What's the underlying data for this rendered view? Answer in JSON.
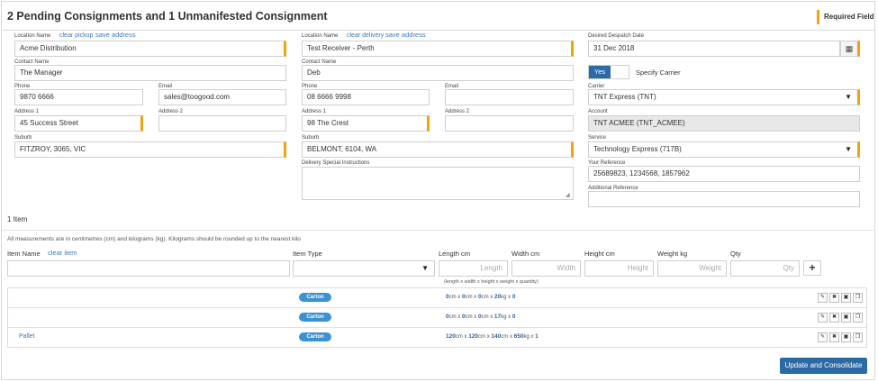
{
  "header": {
    "title": "2 Pending Consignments and 1 Unmanifested Consignment",
    "required_field": "Required Field"
  },
  "pickup": {
    "location_label": "Location Name",
    "clear_link": "clear pickup",
    "save_link": "save address",
    "location": "Acme Distribution",
    "contact_label": "Contact Name",
    "contact": "The Manager",
    "phone_label": "Phone",
    "phone": "9870 6666",
    "email_label": "Email",
    "email": "sales@toogood.com",
    "address1_label": "Address 1",
    "address1": "45 Success Street",
    "address2_label": "Address 2",
    "address2": "",
    "suburb_label": "Suburb",
    "suburb": "FITZROY, 3065, VIC"
  },
  "delivery": {
    "location_label": "Location Name",
    "clear_link": "clear delivery",
    "save_link": "save address",
    "location": "Test Receiver - Perth",
    "contact_label": "Contact Name",
    "contact": "Deb",
    "phone_label": "Phone",
    "phone": "08 6666 9998",
    "email_label": "Email",
    "email": "",
    "address1_label": "Address 1",
    "address1": "98 The Crest",
    "address2_label": "Address 2",
    "address2": "",
    "suburb_label": "Suburb",
    "suburb": "BELMONT, 6104, WA",
    "instructions_label": "Delivery Special Instructions",
    "instructions": ""
  },
  "despatch": {
    "date_label": "Desired Despatch Date",
    "date": "31 Dec 2018",
    "toggle_label": "Yes",
    "specify_carrier": "Specify Carrier",
    "carrier_label": "Carrier",
    "carrier": "TNT Express (TNT)",
    "account_label": "Account",
    "account": "TNT ACMEE (TNT_ACMEE)",
    "service_label": "Service",
    "service": "Technology Express (717B)",
    "your_ref_label": "Your Reference",
    "your_ref": "25689823, 1234568, 1857962",
    "additional_ref_label": "Additional Reference",
    "additional_ref": ""
  },
  "items": {
    "count": "1 Item",
    "note": "All measurements are in centimetres (cm) and kilograms (kg). Kilograms should be rounded up to the nearest kilo",
    "item_name_label": "Item Name",
    "clear_item": "clear item",
    "item_type_label": "Item Type",
    "length_label": "Length cm",
    "width_label": "Width cm",
    "height_label": "Height cm",
    "weight_label": "Weight kg",
    "qty_label": "Qty",
    "length_ph": "Length",
    "width_ph": "Width",
    "height_ph": "Height",
    "weight_ph": "Weight",
    "qty_ph": "Qty",
    "formula_hint": "(length x width x height x weight x quantity)",
    "add_symbol": "+"
  },
  "rows": [
    {
      "name": "",
      "type": "Carton",
      "length": "0",
      "width": "0",
      "height": "0",
      "weight": "20",
      "qty": "0"
    },
    {
      "name": "",
      "type": "Carton",
      "length": "0",
      "width": "0",
      "height": "0",
      "weight": "17",
      "qty": "0"
    },
    {
      "name": "Pallet",
      "type": "Carton",
      "length": "120",
      "width": "120",
      "height": "140",
      "weight": "650",
      "qty": "1"
    }
  ],
  "units": {
    "cm": "cm",
    "kg": "kg",
    "x": "x"
  },
  "actions": {
    "submit": "Update and Consolidate"
  }
}
